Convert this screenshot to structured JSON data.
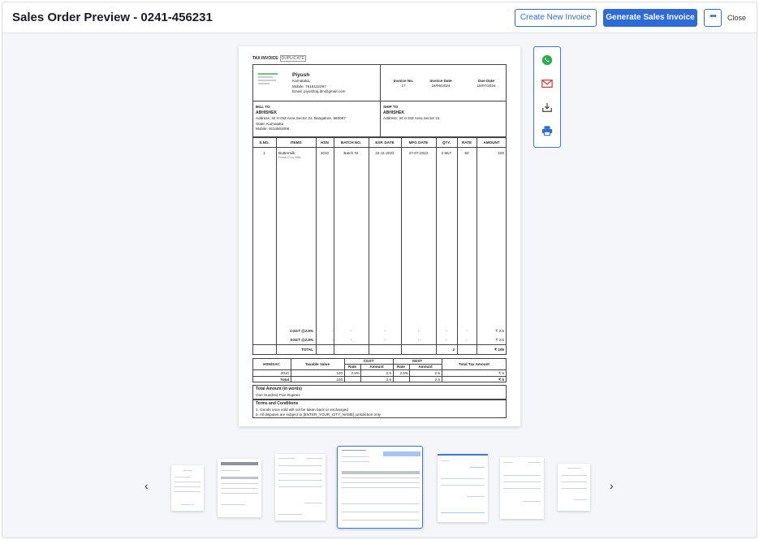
{
  "header": {
    "title": "Sales Order Preview - 0241-456231",
    "create_button": "Create New Invoice",
    "generate_button": "Generate Sales Invoice",
    "more_label": "•••",
    "close_label": "Close"
  },
  "invoice": {
    "doc_title": "TAX INVOICE",
    "copy_tag": "DUPLICATE",
    "seller": {
      "name": "Piyush",
      "state": "Karnataka,",
      "mobile": "Mobile: 7619122297",
      "email": "Email: piyushraj.itm@gmail.com"
    },
    "meta": [
      {
        "label": "Invoice No.",
        "value": "17"
      },
      {
        "label": "Invoice Date",
        "value": "18/06/2024"
      },
      {
        "label": "Due Date",
        "value": "18/07/2024"
      }
    ],
    "bill_to": {
      "heading": "BILL TO",
      "name": "ABHISHEK",
      "address": "Address: 34 H DIZ Area Sector 21, Bangalore, 560067",
      "state": "State: Karnataka",
      "mobile": "Mobile: 9113902006"
    },
    "ship_to": {
      "heading": "SHIP TO",
      "name": "ABHISHEK",
      "address": "Address: 34 H DIZ Area Sector 21"
    },
    "columns": [
      "S.NO.",
      "ITEMS",
      "HSN",
      "BATCH NO.",
      "EXP. DATE",
      "MFG DATE",
      "QTY.",
      "RATE",
      "AMOUNT"
    ],
    "item": {
      "sno": "1",
      "name": "Buttermilk",
      "desc": "Fresh Cow Milk",
      "hsn": "4010",
      "batch": "Batch #4",
      "exp": "24-11-2022",
      "mfg": "27-07-2022",
      "qty": "2 MLT",
      "rate": "50",
      "amount": "100"
    },
    "taxes": [
      {
        "label": "CGST @2.5%",
        "dash": "-",
        "amount": "₹ 2.5"
      },
      {
        "label": "SGST @2.5%",
        "dash": "-",
        "amount": "₹ 2.5"
      }
    ],
    "total_row": {
      "label": "TOTAL",
      "qty": "2",
      "amount": "₹ 105"
    },
    "hsn_table": {
      "h_hsn": "HSN/SAC",
      "h_taxable": "Taxable Value",
      "h_cgst": "CGST",
      "h_sgst": "SGST",
      "h_total": "Total Tax Amount",
      "h_rate": "Rate",
      "h_amount": "Amount",
      "row": {
        "hsn": "4010",
        "taxable": "100",
        "cgst_rate": "2.5%",
        "cgst_amt": "2.5",
        "sgst_rate": "2.5%",
        "sgst_amt": "2.5",
        "total": "₹ 5"
      },
      "total": {
        "label": "Total",
        "taxable": "100",
        "cgst_amt": "2.5",
        "sgst_amt": "2.5",
        "total": "₹ 5"
      }
    },
    "amount_words_label": "Total Amount (in words)",
    "amount_words": "One Hundred Five Rupees",
    "terms_label": "Terms and Conditions",
    "terms": [
      "1. Goods once sold will not be taken back or exchanged",
      "2. All disputes are subject to [ENTER_YOUR_CITY_NAME] jurisdiction only"
    ]
  },
  "share": [
    "whatsapp-icon",
    "email-icon",
    "download-icon",
    "print-icon"
  ],
  "colors": {
    "accent": "#2f6bd8",
    "whatsapp": "#25b04b",
    "email": "#d63a3a",
    "print": "#2f6bd8"
  }
}
